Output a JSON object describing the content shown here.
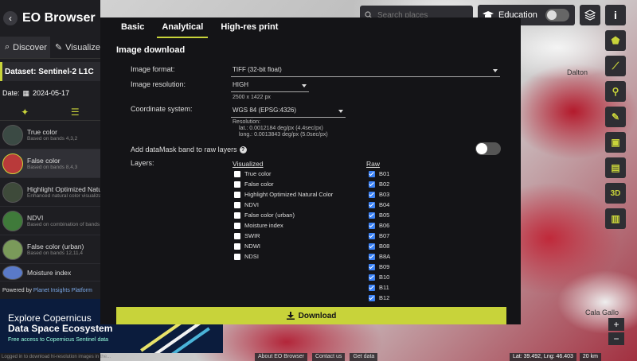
{
  "app": {
    "title": "EO Browser"
  },
  "map": {
    "labels": [
      "Dalton",
      "Cala Gallo"
    ]
  },
  "toolbar": {
    "search_placeholder": "Search places",
    "education_label": "Education",
    "info_label": "i"
  },
  "sidebar": {
    "tabs": [
      "Discover",
      "Visualize"
    ],
    "dataset": "Dataset: Sentinel-2 L1C",
    "date_label": "Date:",
    "date_value": "2024-05-17",
    "layers": [
      {
        "name": "True color",
        "desc": "Based on bands 4,3,2",
        "color": "#4a6a5a"
      },
      {
        "name": "False color",
        "desc": "Based on bands 8,4,3",
        "color": "#b93a3a"
      },
      {
        "name": "Highlight Optimized Natural Color",
        "desc": "Enhanced natural color visualization",
        "color": "#5a6a4a"
      },
      {
        "name": "NDVI",
        "desc": "Based on combination of bands",
        "color": "#3f7a3a"
      },
      {
        "name": "False color (urban)",
        "desc": "Based on bands 12,11,4",
        "color": "#7a9a5a"
      },
      {
        "name": "Moisture index",
        "desc": "",
        "color": "#5a7ac8"
      }
    ],
    "powered_by": "Powered by",
    "powered_by_link": "Planet Insights Platform",
    "banner_title_1": "Explore Copernicus",
    "banner_title_2": "Data Space Ecosystem",
    "banner_sub": "Free access to Copernicus Sentinel data",
    "bottom_note": "Logged in to download hi-resolution images in the..."
  },
  "modal": {
    "tabs": [
      "Basic",
      "Analytical",
      "High-res print"
    ],
    "active_tab": "Analytical",
    "section_title": "Image download",
    "image_format_label": "Image format:",
    "image_format_value": "TIFF (32-bit float)",
    "image_resolution_label": "Image resolution:",
    "image_resolution_value": "HIGH",
    "image_resolution_size": "2500 x 1422 px",
    "coord_system_label": "Coordinate system:",
    "coord_system_value": "WGS 84 (EPSG:4326)",
    "resolution_title": "Resolution:",
    "resolution_lat": "lat.: 0.0012184 deg/px (4.4sec/px)",
    "resolution_long": "long.: 0.0013843 deg/px (5.0sec/px)",
    "datamask_label": "Add dataMask band to raw layers",
    "layers_label": "Layers:",
    "visualized_heading": "Visualized",
    "raw_heading": "Raw",
    "visualized_items": [
      {
        "label": "True color",
        "checked": false
      },
      {
        "label": "False color",
        "checked": false
      },
      {
        "label": "Highlight Optimized Natural Color",
        "checked": false
      },
      {
        "label": "NDVI",
        "checked": false
      },
      {
        "label": "False color (urban)",
        "checked": false
      },
      {
        "label": "Moisture index",
        "checked": false
      },
      {
        "label": "SWIR",
        "checked": false
      },
      {
        "label": "NDWI",
        "checked": false
      },
      {
        "label": "NDSI",
        "checked": false
      }
    ],
    "raw_items": [
      {
        "label": "B01",
        "checked": true
      },
      {
        "label": "B02",
        "checked": true
      },
      {
        "label": "B03",
        "checked": true
      },
      {
        "label": "B04",
        "checked": true
      },
      {
        "label": "B05",
        "checked": true
      },
      {
        "label": "B06",
        "checked": true
      },
      {
        "label": "B07",
        "checked": true
      },
      {
        "label": "B08",
        "checked": true
      },
      {
        "label": "B8A",
        "checked": true
      },
      {
        "label": "B09",
        "checked": true
      },
      {
        "label": "B10",
        "checked": true
      },
      {
        "label": "B11",
        "checked": true
      },
      {
        "label": "B12",
        "checked": true
      }
    ],
    "download_label": "Download"
  },
  "status": {
    "links": [
      "About EO Browser",
      "Contact us",
      "Get data"
    ],
    "coords": "Lat: 39.492, Lng: 46.403",
    "scale": "20 km"
  },
  "colors": {
    "accent": "#c8d33a",
    "panel": "#141417",
    "checkbox": "#3b82f6"
  }
}
